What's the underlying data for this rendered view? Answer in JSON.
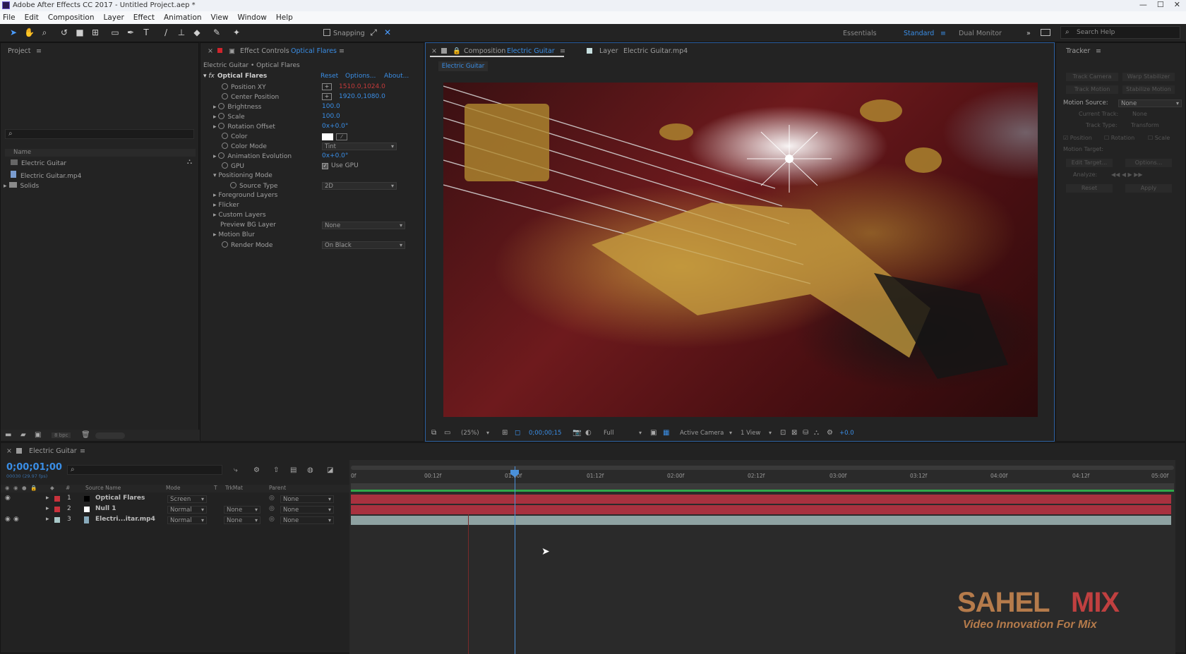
{
  "app": {
    "title": "Adobe After Effects CC 2017 - Untitled Project.aep *",
    "window_controls": [
      "—",
      "☐",
      "✕"
    ]
  },
  "menu": [
    "File",
    "Edit",
    "Composition",
    "Layer",
    "Effect",
    "Animation",
    "View",
    "Window",
    "Help"
  ],
  "toolbar": {
    "snapping_label": "Snapping",
    "workspaces": [
      "Essentials",
      "Standard",
      "Dual Monitor"
    ],
    "active_workspace": "Standard",
    "search_help": "Search Help",
    "more": "»"
  },
  "project": {
    "title": "Project",
    "menu": "≡",
    "search_placeholder": "",
    "column_name": "Name",
    "items": [
      {
        "name": "Electric Guitar",
        "type": "composition"
      },
      {
        "name": "Electric Guitar.mp4",
        "type": "footage"
      },
      {
        "name": "Solids",
        "type": "folder"
      }
    ],
    "bpc": "8 bpc"
  },
  "effect_controls": {
    "tab_title": "Effect Controls",
    "tab_layer": "Optical Flares",
    "breadcrumb": "Electric Guitar • Optical Flares",
    "fx_label": "fx",
    "effect_name": "Optical Flares",
    "links": [
      "Reset",
      "Options...",
      "About..."
    ],
    "props": [
      {
        "name": "Position XY",
        "value": "1510.0,1024.0",
        "color": "red"
      },
      {
        "name": "Center Position",
        "value": "1920.0,1080.0",
        "color": "blue"
      },
      {
        "name": "Brightness",
        "value": "100.0",
        "color": "blue"
      },
      {
        "name": "Scale",
        "value": "100.0",
        "color": "blue"
      },
      {
        "name": "Rotation Offset",
        "value": "0x+0.0°",
        "color": "blue"
      },
      {
        "name": "Color",
        "value": "",
        "color": ""
      },
      {
        "name": "Color Mode",
        "value": "Tint",
        "color": "dropdown"
      },
      {
        "name": "Animation Evolution",
        "value": "0x+0.0°",
        "color": "blue"
      },
      {
        "name": "GPU",
        "value": "Use GPU",
        "color": "checkbox"
      },
      {
        "name": "Positioning Mode",
        "value": "",
        "color": ""
      },
      {
        "name": "Source Type",
        "value": "2D",
        "color": "dropdown"
      },
      {
        "name": "Foreground Layers",
        "value": "",
        "color": ""
      },
      {
        "name": "Flicker",
        "value": "",
        "color": ""
      },
      {
        "name": "Custom Layers",
        "value": "",
        "color": ""
      },
      {
        "name": "Preview BG Layer",
        "value": "None",
        "color": "dropdown"
      },
      {
        "name": "Motion Blur",
        "value": "",
        "color": ""
      },
      {
        "name": "Render Mode",
        "value": "On Black",
        "color": "dropdown"
      }
    ]
  },
  "composition": {
    "tab_comp": "Composition",
    "tab_comp_name": "Electric Guitar",
    "tab_layer": "Layer",
    "tab_layer_name": "Electric Guitar.mp4",
    "sub_tab": "Electric Guitar",
    "menu": "≡",
    "footer": {
      "zoom": "(25%)",
      "timecode": "0;00;00;15",
      "resolution": "Full",
      "camera": "Active Camera",
      "views": "1 View",
      "exposure": "+0.0"
    }
  },
  "tracker": {
    "title": "Tracker",
    "buttons": [
      "Track Camera",
      "Warp Stabilizer",
      "Track Motion",
      "Stabilize Motion"
    ],
    "motion_source_label": "Motion Source:",
    "motion_source": "None",
    "current_track_label": "Current Track:",
    "current_track": "None",
    "track_type_label": "Track Type:",
    "track_type": "Transform",
    "checks": [
      "Position",
      "Rotation",
      "Scale"
    ],
    "motion_target": "Motion Target:",
    "edit_target": "Edit Target...",
    "options": "Options...",
    "analyze": "Analyze:",
    "reset": "Reset",
    "apply": "Apply"
  },
  "timeline": {
    "tab": "Electric Guitar",
    "menu": "≡",
    "timecode": "0;00;01;00",
    "frame_info": "00030 (29.97 fps)",
    "columns": [
      "#",
      "Source Name",
      "Mode",
      "T",
      "TrkMat",
      "Parent"
    ],
    "layers": [
      {
        "num": "1",
        "name": "Optical Flares",
        "mode": "Screen",
        "trkmat": "",
        "parent": "None",
        "label_color": "#c8323c"
      },
      {
        "num": "2",
        "name": "Null 1",
        "mode": "Normal",
        "trkmat": "None",
        "parent": "None",
        "label_color": "#c8323c"
      },
      {
        "num": "3",
        "name": "Electri...itar.mp4",
        "mode": "Normal",
        "trkmat": "None",
        "parent": "None",
        "label_color": "#a8c8c8"
      }
    ],
    "ruler": [
      "0f",
      "00:12f",
      "01:00f",
      "01:12f",
      "02:00f",
      "02:12f",
      "03:00f",
      "03:12f",
      "04:00f",
      "04:12f",
      "05:00f"
    ]
  },
  "watermark": {
    "brand_a": "SAHEL",
    "brand_b": "MIX",
    "tagline": "Video Innovation For Mix"
  }
}
